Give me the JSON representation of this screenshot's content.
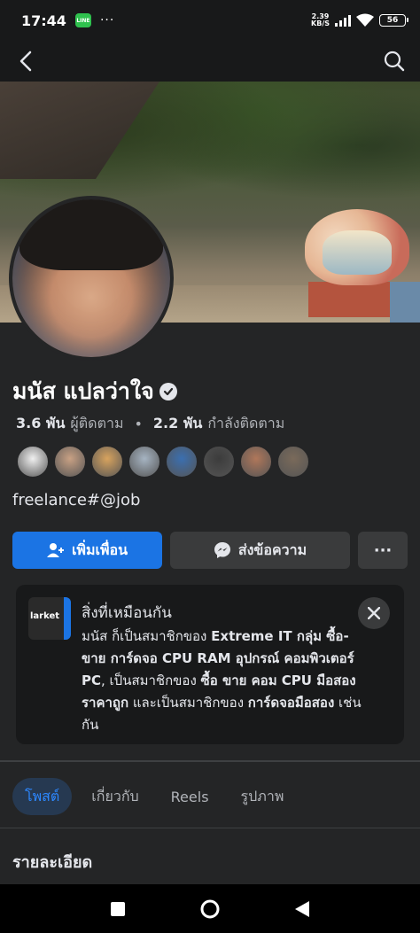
{
  "status_bar": {
    "time": "17:44",
    "app_icon_text": "LINE",
    "dots": "···",
    "net_speed_value": "2.39",
    "net_speed_unit": "KB/S",
    "battery": "56"
  },
  "top_nav": {
    "back_icon": "chevron-left-icon",
    "search_icon": "search-icon"
  },
  "profile": {
    "name": "มนัส แปลว่าใจ",
    "followers_count": "3.6 พัน",
    "followers_label": "ผู้ติดตาม",
    "following_count": "2.2 พัน",
    "following_label": "กำลังติดตาม",
    "bio": "freelance#@job"
  },
  "friends_preview": [
    {
      "color": "#f0f0f0"
    },
    {
      "color": "#c9a184"
    },
    {
      "color": "#d8a35e"
    },
    {
      "color": "#a6b4c2"
    },
    {
      "color": "#3b6fb0"
    },
    {
      "color": "#3c3c3c"
    },
    {
      "color": "#b0775a"
    },
    {
      "color": "#7a6a5a"
    }
  ],
  "actions": {
    "add_friend_label": "เพิ่มเพื่อน",
    "message_label": "ส่งข้อความ",
    "more_label": "···"
  },
  "mutual": {
    "title": "สิ่งที่เหมือนกัน",
    "group_thumb_text": "larket",
    "text_1": "มนัส ก็เป็นสมาชิกของ ",
    "group_1": "Extreme IT กลุ่ม ซื้อ-ขาย การ์ดจอ CPU RAM อุปกรณ์ คอมพิวเตอร์ PC",
    "text_2": ", เป็นสมาชิกของ ",
    "group_2": "ซื้อ ขาย คอม CPU มือสอง ราคาถูก",
    "text_3": " และเป็นสมาชิกของ ",
    "group_3": "การ์ดจอมือสอง",
    "text_4": " เช่นกัน"
  },
  "tabs": [
    {
      "label": "โพสต์",
      "active": true
    },
    {
      "label": "เกี่ยวกับ",
      "active": false
    },
    {
      "label": "Reels",
      "active": false
    },
    {
      "label": "รูปภาพ",
      "active": false
    }
  ],
  "section": {
    "title": "รายละเอียด"
  },
  "colors": {
    "accent": "#1b74e4",
    "background": "#242526",
    "tab_active_bg": "#263951"
  }
}
